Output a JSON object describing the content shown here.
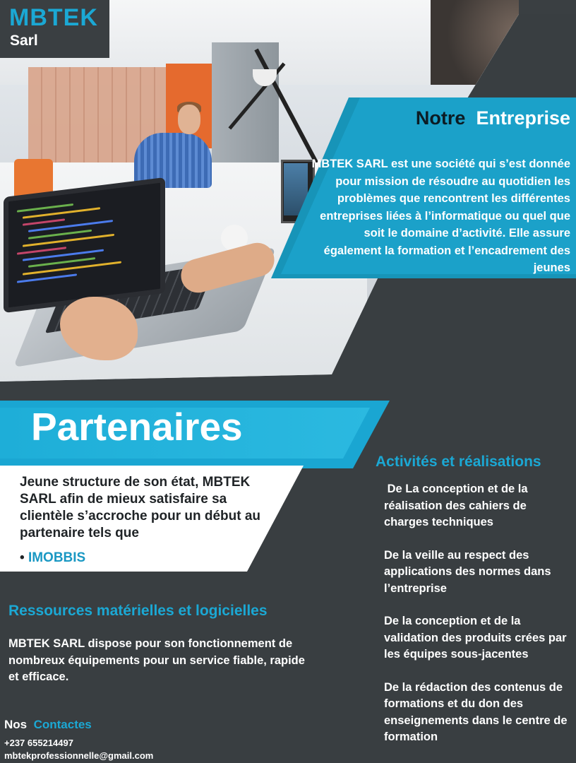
{
  "brand": {
    "name": "MBTEK",
    "suffix": "Sarl"
  },
  "entreprise": {
    "title_word1": "Notre",
    "title_word2": "Entreprise",
    "text": "MBTEK SARL est une société qui s’est donnée pour mission de résoudre au quotidien les problèmes que rencontrent les différentes entreprises liées à l’informatique ou quel que soit le domaine d’activité. Elle assure également la formation et l’encadrement des jeunes"
  },
  "partenaires": {
    "title": "Partenaires",
    "text": "Jeune structure de son état, MBTEK SARL afin de mieux satisfaire sa clientèle s’accroche pour un début au partenaire tels que",
    "bullet": "•",
    "items": [
      "IMOBBIS"
    ]
  },
  "activites": {
    "title": "Activités et réalisations",
    "items": [
      " De La conception et de la réalisation des cahiers de charges techniques",
      "De la veille au respect des applications des normes dans l’entreprise",
      "De la conception et de la validation des produits crées par les équipes sous-jacentes",
      "De la rédaction des contenus de formations et du don des enseignements dans le centre de formation"
    ]
  },
  "ressources": {
    "title": "Ressources matérielles et logicielles",
    "text": "MBTEK SARL dispose pour son fonctionnement de nombreux équipements pour un service fiable, rapide et efficace."
  },
  "contact": {
    "title_word1": "Nos",
    "title_word2": "Contactes",
    "phone": "+237 655214497",
    "email": "mbtekprofessionnelle@gmail.com"
  },
  "colors": {
    "accent": "#1ba8d4",
    "dark": "#393e41",
    "white": "#ffffff"
  },
  "image": {
    "subject": "developer-working-on-laptop-photo"
  }
}
